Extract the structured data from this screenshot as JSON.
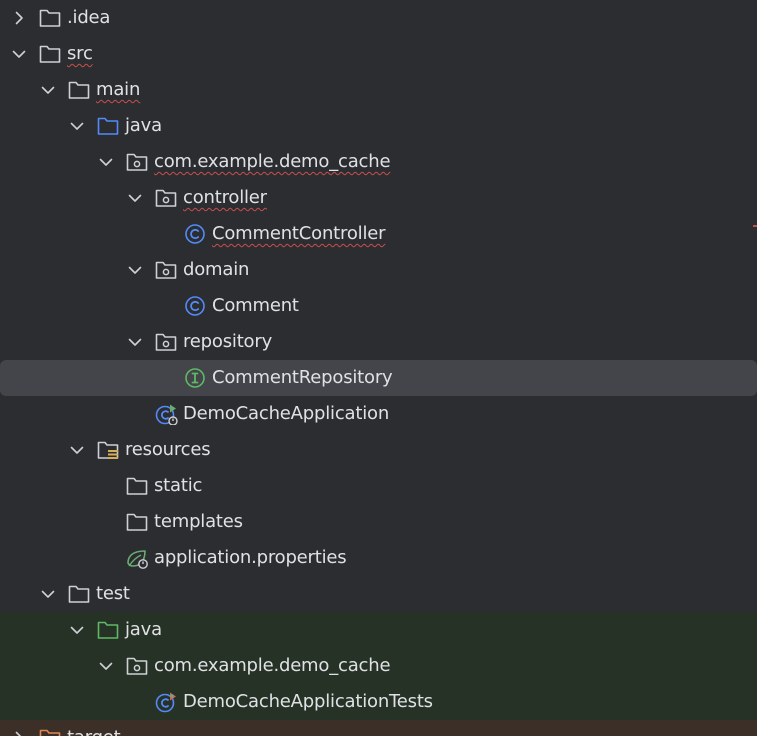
{
  "tree": {
    "nodes": [
      {
        "label": ".idea",
        "depth": 0,
        "chevron": "right",
        "icon": "folder-icon",
        "squiggle": false
      },
      {
        "label": "src",
        "depth": 0,
        "chevron": "down",
        "icon": "folder-icon",
        "squiggle": true
      },
      {
        "label": "main",
        "depth": 1,
        "chevron": "down",
        "icon": "folder-icon",
        "squiggle": true
      },
      {
        "label": "java",
        "depth": 2,
        "chevron": "down",
        "icon": "source-root-folder-icon",
        "squiggle": false
      },
      {
        "label": "com.example.demo_cache",
        "depth": 3,
        "chevron": "down",
        "icon": "package-icon",
        "squiggle": true
      },
      {
        "label": "controller",
        "depth": 4,
        "chevron": "down",
        "icon": "package-icon",
        "squiggle": true
      },
      {
        "label": "CommentController",
        "depth": 5,
        "chevron": "none",
        "icon": "class-icon",
        "squiggle": true
      },
      {
        "label": "domain",
        "depth": 4,
        "chevron": "down",
        "icon": "package-icon",
        "squiggle": false
      },
      {
        "label": "Comment",
        "depth": 5,
        "chevron": "none",
        "icon": "class-icon",
        "squiggle": false
      },
      {
        "label": "repository",
        "depth": 4,
        "chevron": "down",
        "icon": "package-icon",
        "squiggle": false
      },
      {
        "label": "CommentRepository",
        "depth": 5,
        "chevron": "none",
        "icon": "interface-icon",
        "squiggle": false,
        "selected": true
      },
      {
        "label": "DemoCacheApplication",
        "depth": 4,
        "chevron": "none",
        "icon": "spring-boot-class-icon",
        "squiggle": false
      },
      {
        "label": "resources",
        "depth": 2,
        "chevron": "down",
        "icon": "resources-folder-icon",
        "squiggle": false
      },
      {
        "label": "static",
        "depth": 3,
        "chevron": "none",
        "icon": "folder-icon",
        "squiggle": false
      },
      {
        "label": "templates",
        "depth": 3,
        "chevron": "none",
        "icon": "folder-icon",
        "squiggle": false
      },
      {
        "label": "application.properties",
        "depth": 3,
        "chevron": "none",
        "icon": "spring-properties-icon",
        "squiggle": false
      },
      {
        "label": "test",
        "depth": 1,
        "chevron": "down",
        "icon": "folder-icon",
        "squiggle": false
      },
      {
        "label": "java",
        "depth": 2,
        "chevron": "down",
        "icon": "test-root-folder-icon",
        "squiggle": false,
        "tint": "test"
      },
      {
        "label": "com.example.demo_cache",
        "depth": 3,
        "chevron": "down",
        "icon": "package-icon",
        "squiggle": false,
        "tint": "test"
      },
      {
        "label": "DemoCacheApplicationTests",
        "depth": 4,
        "chevron": "none",
        "icon": "spring-boot-test-class-icon",
        "squiggle": false,
        "tint": "test"
      },
      {
        "label": "target",
        "depth": 0,
        "chevron": "right",
        "icon": "excluded-folder-icon",
        "squiggle": false,
        "tint": "target"
      }
    ]
  },
  "colors": {
    "background": "#2b2d30",
    "text": "#dfe1e5",
    "selection": "#43454a",
    "test_tint": "#273227",
    "target_tint": "#3b2f27",
    "folder_stroke": "#ced0d6",
    "source_root_stroke": "#548af7",
    "test_root_stroke": "#5fb865",
    "class_stroke": "#548af7",
    "interface_stroke": "#5fb865",
    "spring_green": "#6aab73",
    "resources_lines": "#d6ae58",
    "excluded_stroke": "#e08855"
  }
}
